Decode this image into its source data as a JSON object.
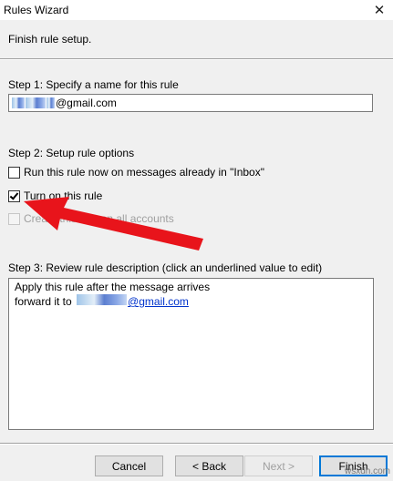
{
  "window": {
    "title": "Rules Wizard",
    "close_glyph": "✕"
  },
  "header": {
    "subtitle": "Finish rule setup."
  },
  "step1": {
    "label": "Step 1: Specify a name for this rule",
    "name_value_visible": "@gmail.com"
  },
  "step2": {
    "label": "Step 2: Setup rule options",
    "options": [
      {
        "label": "Run this rule now on messages already in \"Inbox\"",
        "checked": false,
        "enabled": true
      },
      {
        "label": "Turn on this rule",
        "checked": true,
        "enabled": true
      },
      {
        "label": "Create this rule on all accounts",
        "checked": false,
        "enabled": false
      }
    ]
  },
  "step3": {
    "label": "Step 3: Review rule description (click an underlined value to edit)",
    "line1": "Apply this rule after the message arrives",
    "line2_prefix": "forward it to",
    "line2_link": "@gmail.com"
  },
  "buttons": {
    "cancel": "Cancel",
    "back": "< Back",
    "next": "Next >",
    "finish": "Finish"
  },
  "watermark": "wsxdn.com",
  "colors": {
    "arrow": "#e8141b",
    "link": "#0033cc",
    "focus_border": "#0078d7"
  },
  "icons": {
    "close": "close-icon",
    "annotation": "red-arrow-annotation"
  }
}
